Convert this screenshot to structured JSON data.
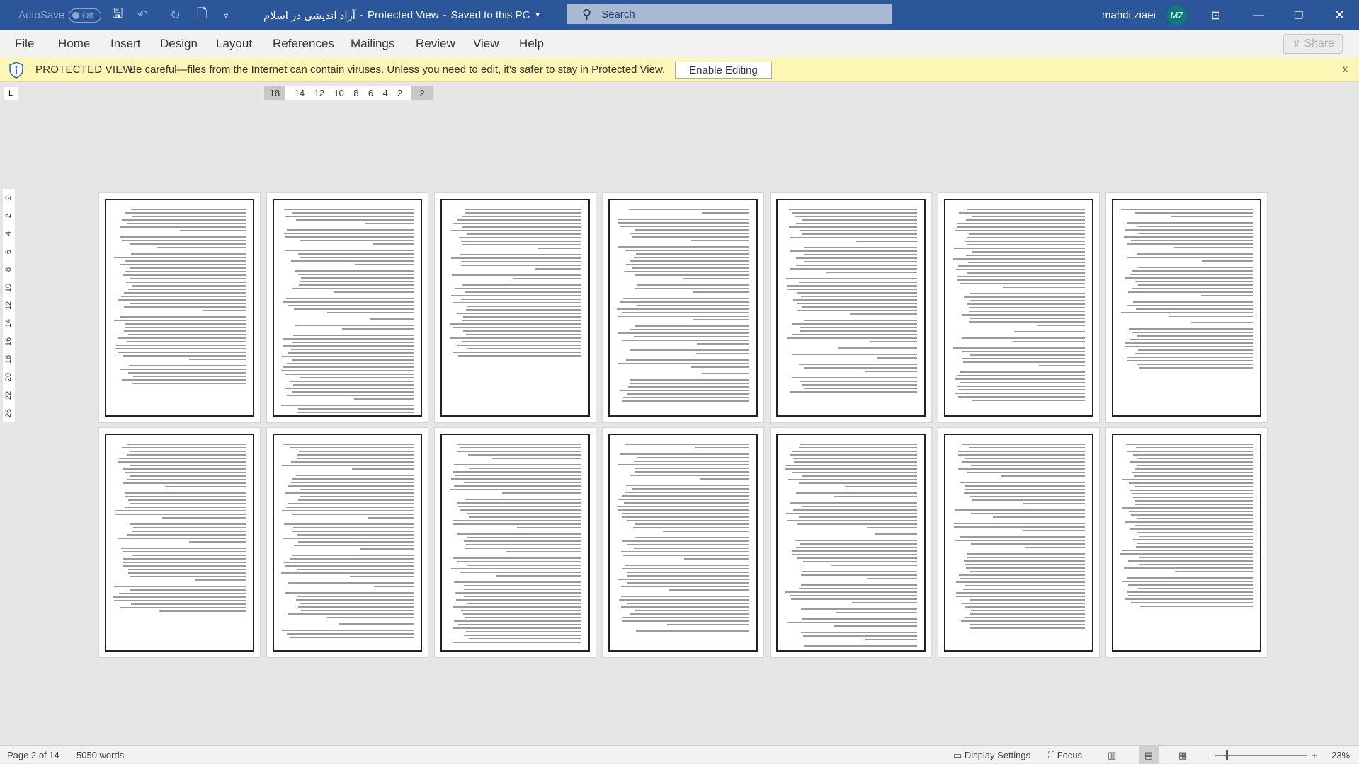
{
  "titlebar": {
    "autosave": "AutoSave",
    "autosave_state": "Off",
    "doc_title": "آزاد اندیشی در اسلام",
    "separator1": "-",
    "view_mode": "Protected View",
    "separator2": "-",
    "save_state": "Saved to this PC",
    "search_placeholder": "Search",
    "user_name": "mahdi ziaei",
    "user_initials": "MZ",
    "avatar_color": "#0c7b7b",
    "accent": "#2b579a"
  },
  "ribbon": {
    "tabs": [
      "File",
      "Home",
      "Insert",
      "Design",
      "Layout",
      "References",
      "Mailings",
      "Review",
      "View",
      "Help"
    ],
    "share": "Share"
  },
  "protected_view": {
    "title": "PROTECTED VIEW",
    "message": "Be careful—files from the Internet can contain viruses. Unless you need to edit, it's safer to stay in Protected View.",
    "enable_button": "Enable Editing",
    "close": "x",
    "bar_color": "#fdf7b6"
  },
  "ruler": {
    "left": "18",
    "ticks": [
      "14",
      "12",
      "10",
      "8",
      "6",
      "4",
      "2"
    ],
    "right": "2",
    "corner": "L"
  },
  "vruler": {
    "ticks": [
      "2",
      "2",
      "4",
      "6",
      "8",
      "10",
      "12",
      "14",
      "16",
      "18",
      "20",
      "22",
      "26"
    ]
  },
  "document": {
    "page_count_shown": 14
  },
  "status": {
    "page": "Page 2 of 14",
    "words": "5050 words",
    "display_settings": "Display Settings",
    "focus": "Focus",
    "zoom_minus": "-",
    "zoom_plus": "+",
    "zoom": "23%",
    "zoom_level_percent": 23
  }
}
